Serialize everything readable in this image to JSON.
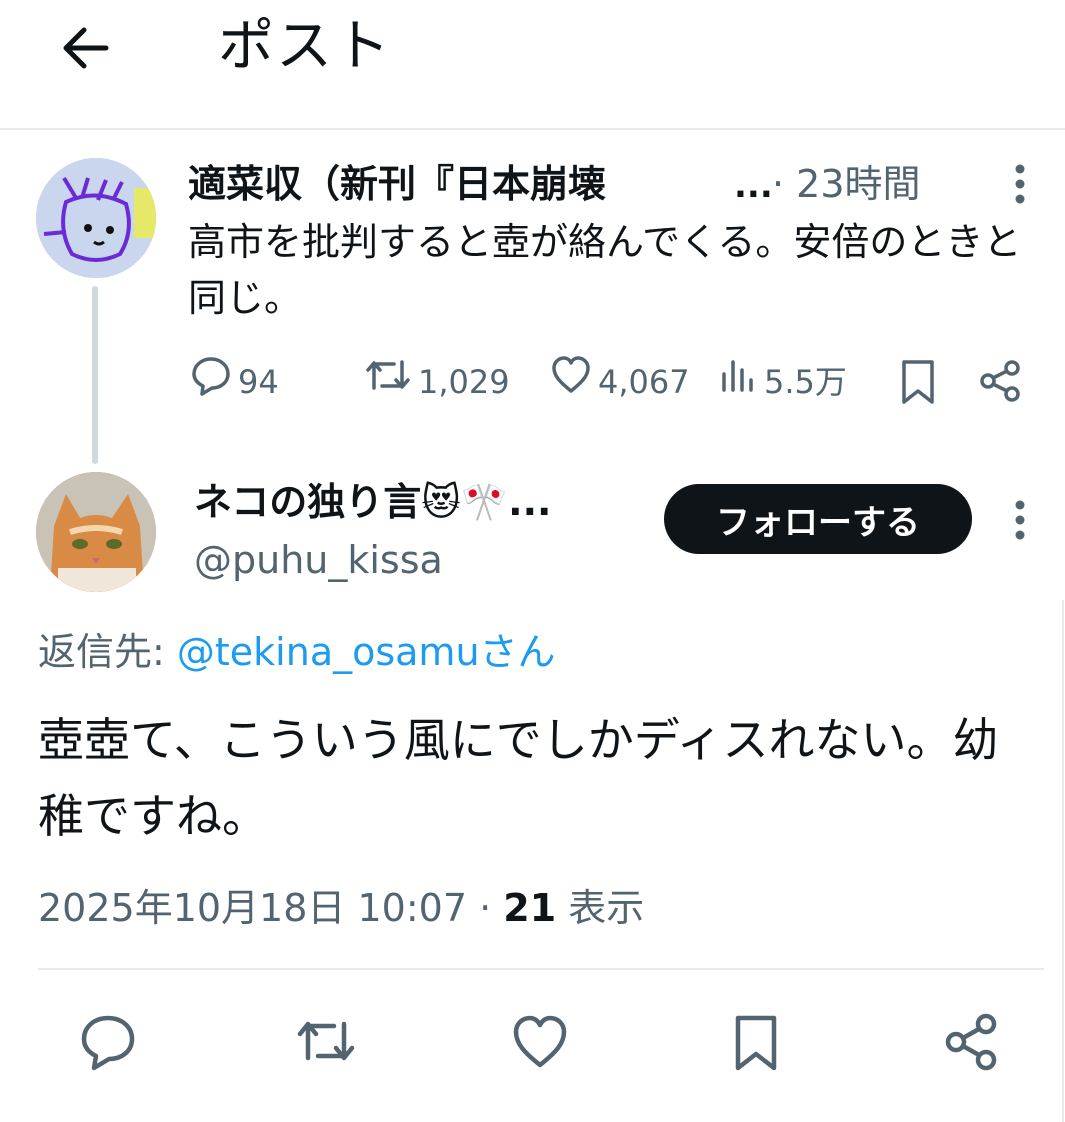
{
  "header": {
    "title": "ポスト"
  },
  "original_post": {
    "author_name": "適菜収（新刊『日本崩壊",
    "ellipsis": "...",
    "time": "· 23時間",
    "text": "高市を批判すると壺が絡んでくる。安倍のときと同じ。",
    "stats": {
      "replies": "94",
      "reposts": "1,029",
      "likes": "4,067",
      "views": "5.5万"
    }
  },
  "reply": {
    "author_name": "ネコの独り言😻🎌...",
    "handle": "@puhu_kissa",
    "follow_label": "フォローする",
    "reply_to_prefix": "返信先: ",
    "reply_to_mention": "@tekina_osamu",
    "reply_to_suffix": "さん",
    "text": "壺壺て、こういう風にでしかディスれない。幼稚ですね。",
    "datetime": "2025年10月18日 10:07 · ",
    "views_count": "21",
    "views_label": " 表示"
  },
  "colors": {
    "text": "#0f1419",
    "secondary": "#536471",
    "link": "#1d9bf0",
    "divider": "#e7e9ea",
    "button": "#0f1419"
  },
  "icons": [
    "back-arrow-icon",
    "more-vertical-icon",
    "reply-icon",
    "repost-icon",
    "like-icon",
    "views-icon",
    "bookmark-icon",
    "share-icon"
  ]
}
